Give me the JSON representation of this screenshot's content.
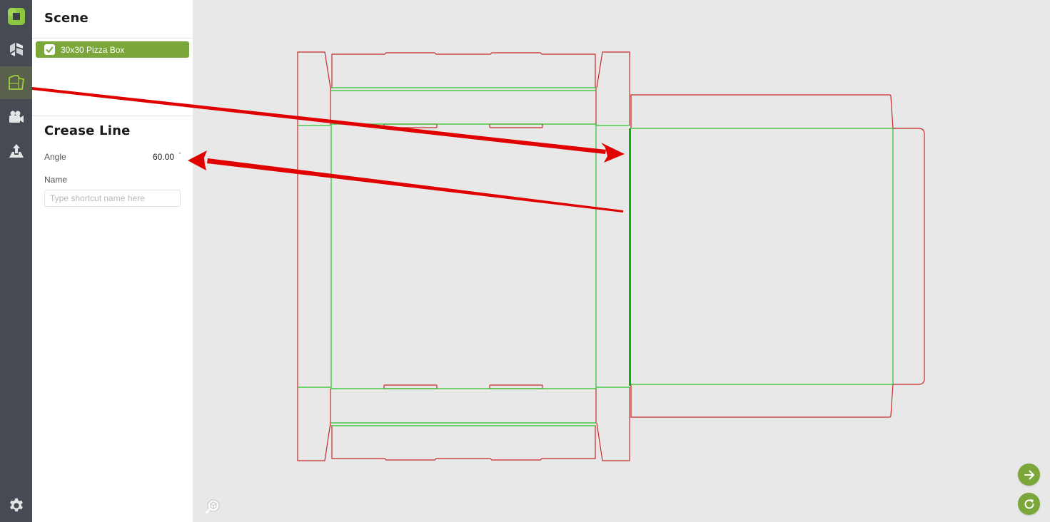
{
  "rail": {
    "items": [
      {
        "name": "logo",
        "icon": "app-logo-icon"
      },
      {
        "name": "models",
        "icon": "model-blocks-icon"
      },
      {
        "name": "dieline",
        "icon": "dieline-folder-icon",
        "active": true
      },
      {
        "name": "camera",
        "icon": "video-camera-icon"
      },
      {
        "name": "export",
        "icon": "upload-export-icon"
      },
      {
        "name": "settings",
        "icon": "gear-icon"
      }
    ]
  },
  "scene": {
    "title": "Scene",
    "items": [
      {
        "label": "30x30 Pizza Box",
        "checked": true
      }
    ]
  },
  "properties": {
    "title": "Crease Line",
    "angle": {
      "label": "Angle",
      "value": "60.00",
      "unit": "°"
    },
    "name": {
      "label": "Name",
      "value": "",
      "placeholder": "Type shortcut name here"
    }
  },
  "canvas": {
    "cut_color": "#c62a2a",
    "crease_color": "#2bc42b",
    "annotation_color": "#e00000",
    "selected_crease": "right side panel crease line"
  },
  "floating_buttons": {
    "next": {
      "icon": "arrow-right-icon"
    },
    "reset": {
      "icon": "refresh-icon"
    },
    "view": {
      "icon": "view-cube-icon"
    }
  },
  "colors": {
    "accent": "#7aa63a",
    "rail_bg": "#464a52",
    "rail_active": "#59604e",
    "canvas_bg": "#e8e8e8"
  }
}
